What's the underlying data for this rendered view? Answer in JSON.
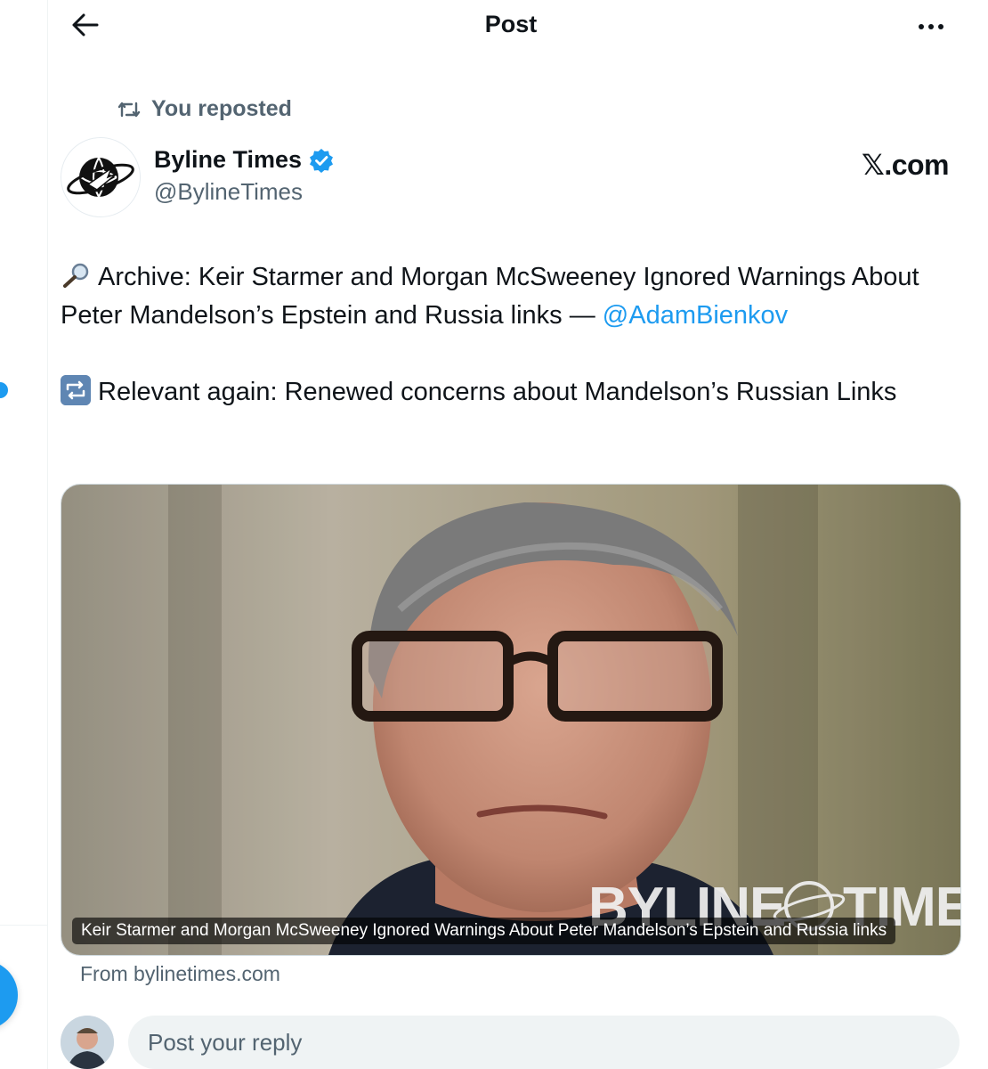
{
  "header": {
    "title": "Post",
    "back_icon": "arrow-left-icon",
    "more_icon": "more-horizontal-icon"
  },
  "repost_context": {
    "icon": "repost-icon",
    "label": "You reposted"
  },
  "author": {
    "name": "Byline Times",
    "handle": "@BylineTimes",
    "verified_icon": "verified-badge-icon",
    "source_label": "𝕏.com"
  },
  "tweet": {
    "line1_emoji": "magnifying-glass-icon",
    "line1_text": "Archive: Keir Starmer and Morgan McSweeney Ignored Warnings About Peter Mandelson’s Epstein and Russia links — ",
    "mention": "@AdamBienkov",
    "line2_emoji": "repeat-icon",
    "line2_text": "Relevant again: Renewed concerns about Mandelson’s Russian Links"
  },
  "card": {
    "caption": "Keir Starmer and Morgan McSweeney Ignored Warnings About Peter Mandelson’s Epstein and Russia links",
    "watermark": "BYLINE TIMES",
    "source": "From bylinetimes.com"
  },
  "reply": {
    "placeholder": "Post your reply"
  },
  "colors": {
    "accent": "#1d9bf0",
    "text_primary": "#0f1419",
    "text_secondary": "#536471",
    "reply_bg": "#eff3f4"
  }
}
